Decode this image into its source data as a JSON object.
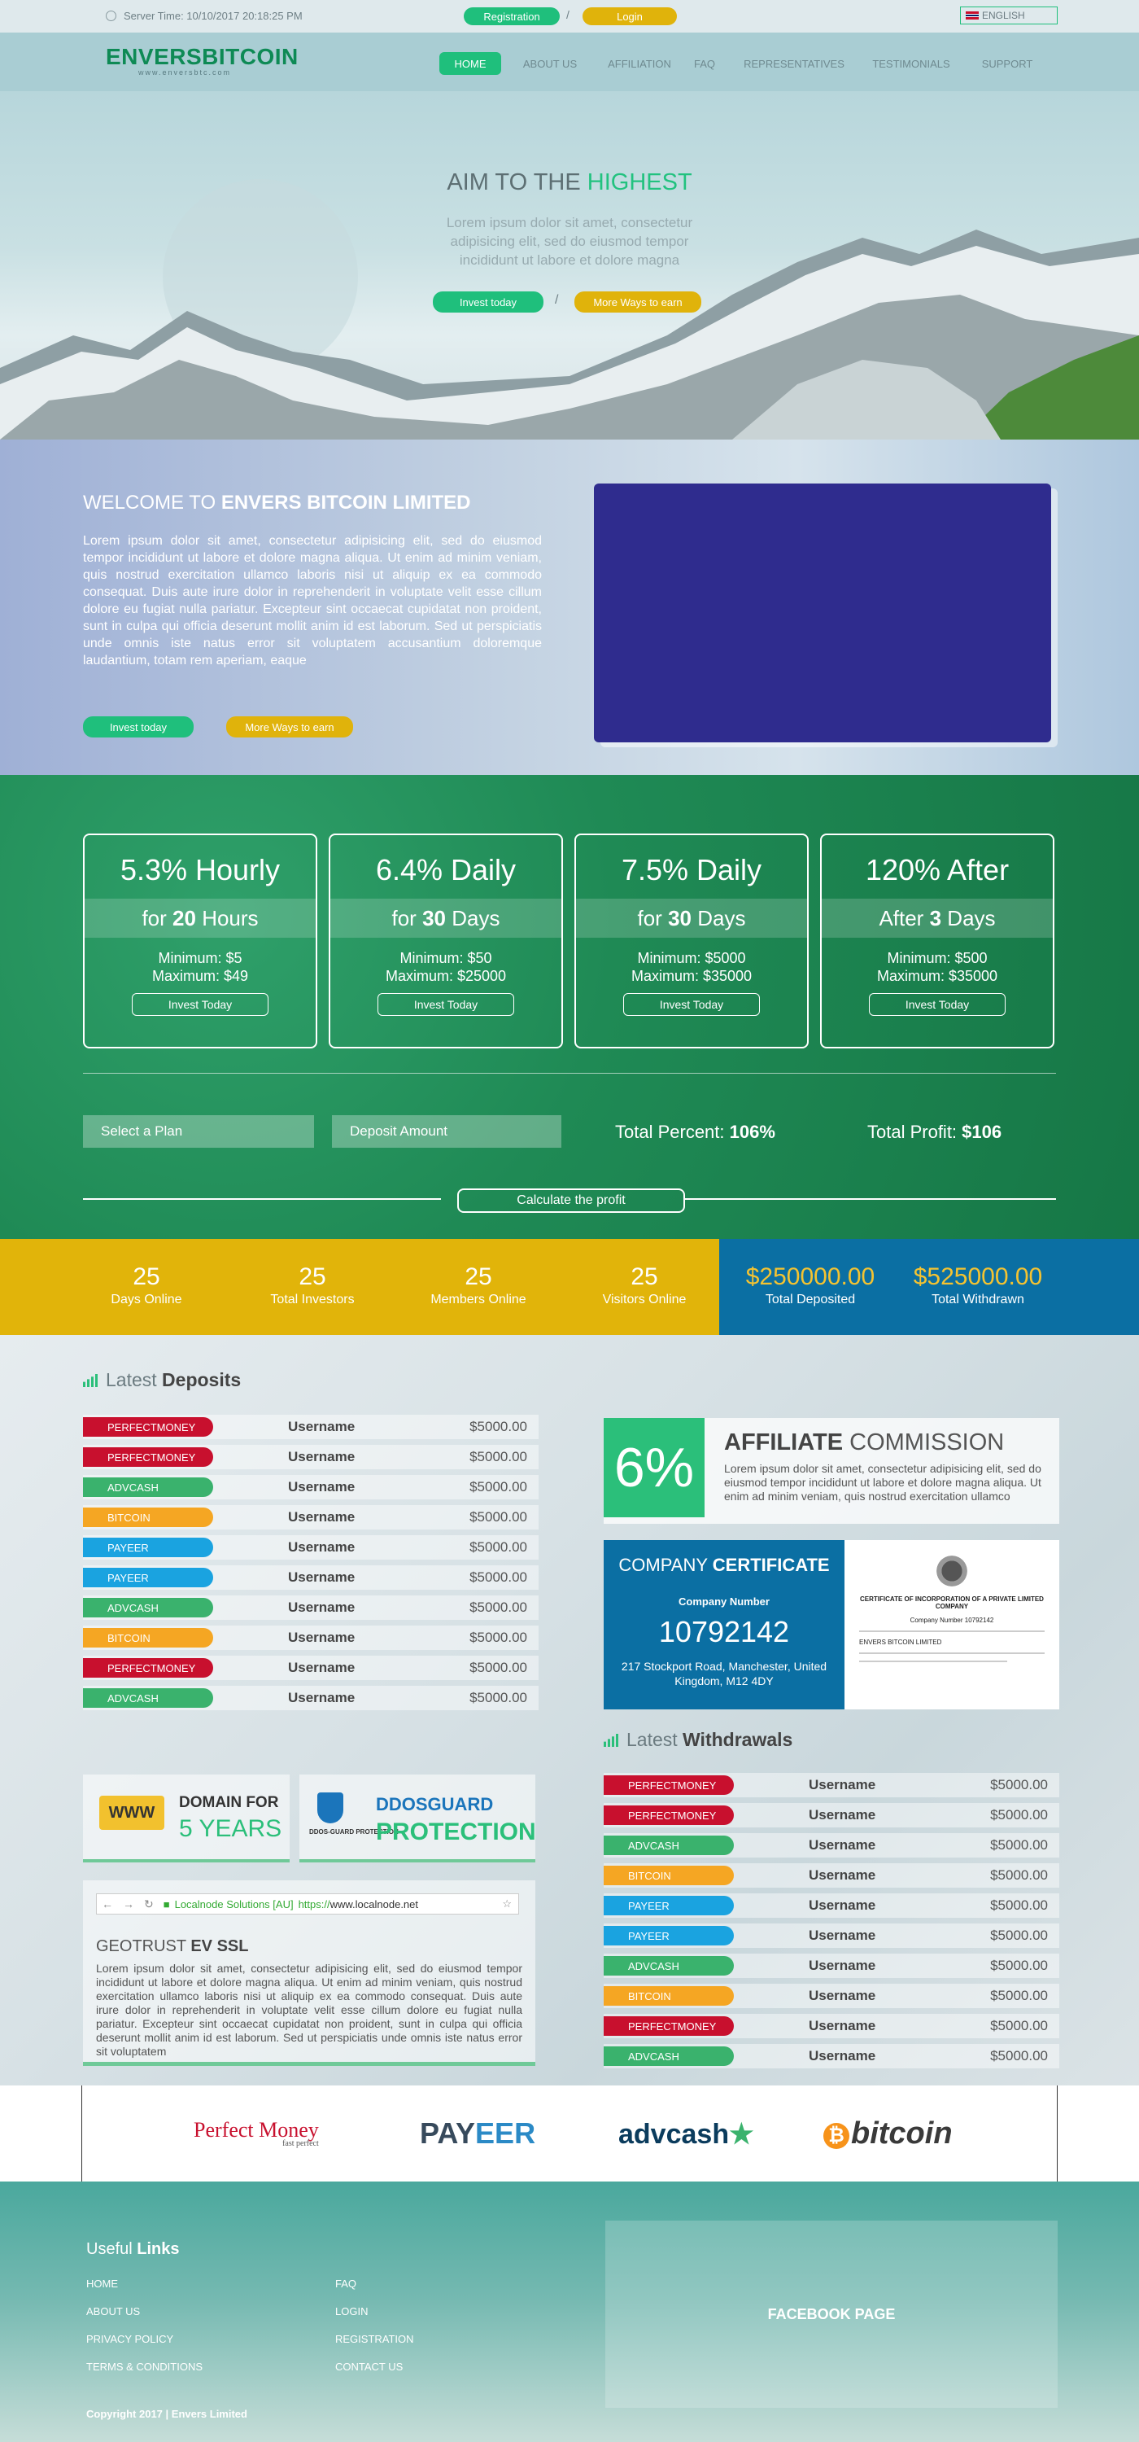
{
  "topbar": {
    "server_time": "Server Time: 10/10/2017 20:18:25 PM",
    "registration": "Registration",
    "separator": "/",
    "login": "Login",
    "language": "ENGLISH"
  },
  "header": {
    "logo": "ENVERSBITCOIN",
    "tagline": "www.enversbtc.com",
    "nav": [
      "HOME",
      "ABOUT US",
      "AFFILIATION",
      "FAQ",
      "REPRESENTATIVES",
      "TESTIMONIALS",
      "SUPPORT"
    ],
    "active_nav": "HOME"
  },
  "hero": {
    "title_prefix": "AIM TO THE",
    "title_highlight": "HIGHEST",
    "text": "Lorem ipsum dolor sit amet, consectetur adipisicing elit, sed do eiusmod tempor incididunt ut labore et dolore magna",
    "invest_button": "Invest today",
    "separator": "/",
    "more_button": "More Ways to earn"
  },
  "welcome": {
    "title_prefix": "WELCOME TO",
    "title_bold": "ENVERS BITCOIN LIMITED",
    "text": "Lorem ipsum dolor sit amet, consectetur adipisicing elit, sed do eiusmod tempor incididunt ut labore et dolore magna aliqua. Ut enim ad minim veniam, quis nostrud exercitation ullamco laboris nisi ut aliquip ex ea commodo consequat. Duis aute irure dolor in reprehenderit in voluptate velit esse cillum dolore eu fugiat nulla pariatur. Excepteur sint occaecat cupidatat non proident, sunt in culpa qui officia deserunt mollit anim id est laborum. Sed ut perspiciatis unde omnis iste natus error sit voluptatem accusantium doloremque laudantium, totam rem aperiam, eaque",
    "invest_button": "Invest today",
    "more_button": "More Ways to earn"
  },
  "plans": [
    {
      "rate": "5.3%",
      "rate_label": "Hourly",
      "period_prefix": "for",
      "period_num": "20",
      "period_unit": "Hours",
      "minimum": "Minimum: $5",
      "maximum": "Maximum: $49",
      "button": "Invest Today"
    },
    {
      "rate": "6.4%",
      "rate_label": "Daily",
      "period_prefix": "for",
      "period_num": "30",
      "period_unit": "Days",
      "minimum": "Minimum: $50",
      "maximum": "Maximum: $25000",
      "button": "Invest Today"
    },
    {
      "rate": "7.5%",
      "rate_label": "Daily",
      "period_prefix": "for",
      "period_num": "30",
      "period_unit": "Days",
      "minimum": "Minimum: $5000",
      "maximum": "Maximum: $35000",
      "button": "Invest Today"
    },
    {
      "rate": "120%",
      "rate_label": "After",
      "period_prefix": "After",
      "period_num": "3",
      "period_unit": "Days",
      "minimum": "Minimum: $500",
      "maximum": "Maximum: $35000",
      "button": "Invest Today"
    }
  ],
  "calculator": {
    "plan_placeholder": "Select a Plan",
    "amount_placeholder": "Deposit Amount",
    "total_percent_label": "Total Percent:",
    "total_percent_value": "106%",
    "total_profit_label": "Total Profit:",
    "total_profit_value": "$106",
    "calc_button": "Calculate the profit"
  },
  "stats": [
    {
      "value": "25",
      "label": "Days Online"
    },
    {
      "value": "25",
      "label": "Total Investors"
    },
    {
      "value": "25",
      "label": "Members Online"
    },
    {
      "value": "25",
      "label": "Visitors Online"
    },
    {
      "value": "$250000.00",
      "label": "Total Deposited"
    },
    {
      "value": "$525000.00",
      "label": "Total Withdrawn"
    }
  ],
  "deposits": {
    "title_prefix": "Latest",
    "title_bold": "Deposits",
    "rows": [
      {
        "method": "PERFECTMONEY",
        "user": "Username",
        "amount": "$5000.00"
      },
      {
        "method": "PERFECTMONEY",
        "user": "Username",
        "amount": "$5000.00"
      },
      {
        "method": "ADVCASH",
        "user": "Username",
        "amount": "$5000.00"
      },
      {
        "method": "BITCOIN",
        "user": "Username",
        "amount": "$5000.00"
      },
      {
        "method": "PAYEER",
        "user": "Username",
        "amount": "$5000.00"
      },
      {
        "method": "PAYEER",
        "user": "Username",
        "amount": "$5000.00"
      },
      {
        "method": "ADVCASH",
        "user": "Username",
        "amount": "$5000.00"
      },
      {
        "method": "BITCOIN",
        "user": "Username",
        "amount": "$5000.00"
      },
      {
        "method": "PERFECTMONEY",
        "user": "Username",
        "amount": "$5000.00"
      },
      {
        "method": "ADVCASH",
        "user": "Username",
        "amount": "$5000.00"
      }
    ]
  },
  "withdrawals": {
    "title_prefix": "Latest",
    "title_bold": "Withdrawals",
    "rows": [
      {
        "method": "PERFECTMONEY",
        "user": "Username",
        "amount": "$5000.00"
      },
      {
        "method": "PERFECTMONEY",
        "user": "Username",
        "amount": "$5000.00"
      },
      {
        "method": "ADVCASH",
        "user": "Username",
        "amount": "$5000.00"
      },
      {
        "method": "BITCOIN",
        "user": "Username",
        "amount": "$5000.00"
      },
      {
        "method": "PAYEER",
        "user": "Username",
        "amount": "$5000.00"
      },
      {
        "method": "PAYEER",
        "user": "Username",
        "amount": "$5000.00"
      },
      {
        "method": "ADVCASH",
        "user": "Username",
        "amount": "$5000.00"
      },
      {
        "method": "BITCOIN",
        "user": "Username",
        "amount": "$5000.00"
      },
      {
        "method": "PERFECTMONEY",
        "user": "Username",
        "amount": "$5000.00"
      },
      {
        "method": "ADVCASH",
        "user": "Username",
        "amount": "$5000.00"
      }
    ]
  },
  "method_colors": {
    "PERFECTMONEY": "#c8102e",
    "ADVCASH": "#3ab26d",
    "BITCOIN": "#f5a623",
    "PAYEER": "#1aa3e0"
  },
  "affiliate": {
    "percent": "6%",
    "title_bold": "AFFILIATE",
    "title_rest": "COMMISSION",
    "text": "Lorem ipsum dolor sit amet, consectetur adipisicing elit, sed do eiusmod tempor incididunt ut labore et dolore magna aliqua. Ut enim ad minim veniam, quis nostrud exercitation ullamco"
  },
  "certificate": {
    "title_prefix": "COMPANY",
    "title_bold": "CERTIFICATE",
    "number_label": "Company Number",
    "number": "10792142",
    "address": "217 Stockport Road, Manchester, United Kingdom, M12 4DY",
    "doc_title": "CERTIFICATE OF INCORPORATION OF A PRIVATE LIMITED COMPANY",
    "doc_number": "Company Number 10792142",
    "doc_company": "ENVERS BITCOIN LIMITED"
  },
  "domain_box": {
    "badge": "WWW",
    "line1": "DOMAIN FOR",
    "line2": "5 YEARS"
  },
  "ddos_box": {
    "small_label": "DDOS-GUARD PROTECTION",
    "line1": "DDOSGUARD",
    "line2": "PROTECTION"
  },
  "ssl": {
    "company": "Localnode Solutions [AU]",
    "url_prefix": "https://",
    "url": "www.localnode.net",
    "title_prefix": "GEOTRUST",
    "title_bold": "EV SSL",
    "text": "Lorem ipsum dolor sit amet, consectetur adipisicing elit, sed do eiusmod tempor incididunt ut labore et dolore magna aliqua. Ut enim ad minim veniam, quis nostrud exercitation ullamco laboris nisi ut aliquip ex ea commodo consequat. Duis aute irure dolor in reprehenderit in voluptate velit esse cillum dolore eu fugiat nulla pariatur. Excepteur sint occaecat cupidatat non proident, sunt in culpa qui officia deserunt mollit anim id est laborum. Sed ut perspiciatis unde omnis iste natus error sit voluptatem"
  },
  "payment_logos": {
    "perfect_money": "Perfect Money",
    "perfect_money_tag": "fast perfect",
    "payeer_a": "PAY",
    "payeer_b": "EER",
    "advcash": "advcash",
    "bitcoin": "bitcoin"
  },
  "footer": {
    "title_prefix": "Useful",
    "title_bold": "Links",
    "links_left": [
      "HOME",
      "ABOUT US",
      "PRIVACY POLICY",
      "TERMS & CONDITIONS"
    ],
    "links_right": [
      "FAQ",
      "LOGIN",
      "REGISTRATION",
      "CONTACT US"
    ],
    "facebook": "FACEBOOK PAGE",
    "copyright": "Copyright 2017 | Envers Limited"
  }
}
